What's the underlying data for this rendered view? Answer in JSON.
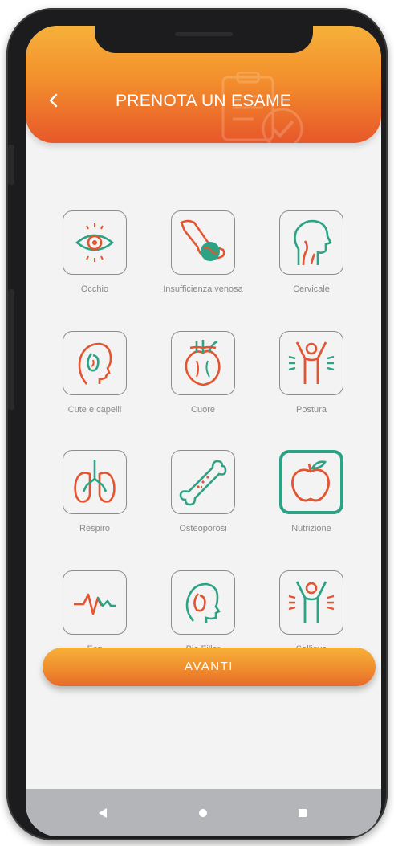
{
  "header": {
    "title": "PRENOTA UN ESAME",
    "back_icon": "chevron-left-icon"
  },
  "exams": [
    {
      "label": "Occhio",
      "icon": "eye-icon",
      "selected": false
    },
    {
      "label": "Insufficienza venosa",
      "icon": "leg-vein-icon",
      "selected": false
    },
    {
      "label": "Cervicale",
      "icon": "neck-profile-icon",
      "selected": false
    },
    {
      "label": "Cute e capelli",
      "icon": "skin-hair-icon",
      "selected": false
    },
    {
      "label": "Cuore",
      "icon": "heart-icon",
      "selected": false
    },
    {
      "label": "Postura",
      "icon": "posture-icon",
      "selected": false
    },
    {
      "label": "Respiro",
      "icon": "lungs-icon",
      "selected": false
    },
    {
      "label": "Osteoporosi",
      "icon": "bone-icon",
      "selected": false
    },
    {
      "label": "Nutrizione",
      "icon": "apple-icon",
      "selected": true
    },
    {
      "label": "Ecg",
      "icon": "ecg-icon",
      "selected": false
    },
    {
      "label": "Bio Filler",
      "icon": "face-profile-icon",
      "selected": false
    },
    {
      "label": "Sollievo",
      "icon": "relief-icon",
      "selected": false
    }
  ],
  "cta": {
    "label": "AVANTI"
  },
  "navbar": {
    "back": "triangle-back-icon",
    "home": "circle-home-icon",
    "recents": "square-recents-icon"
  },
  "colors": {
    "header_top": "#f6b13a",
    "header_bottom": "#e7572a",
    "icon_red": "#e35430",
    "icon_green": "#2ba384",
    "background": "#f3f3f3"
  }
}
